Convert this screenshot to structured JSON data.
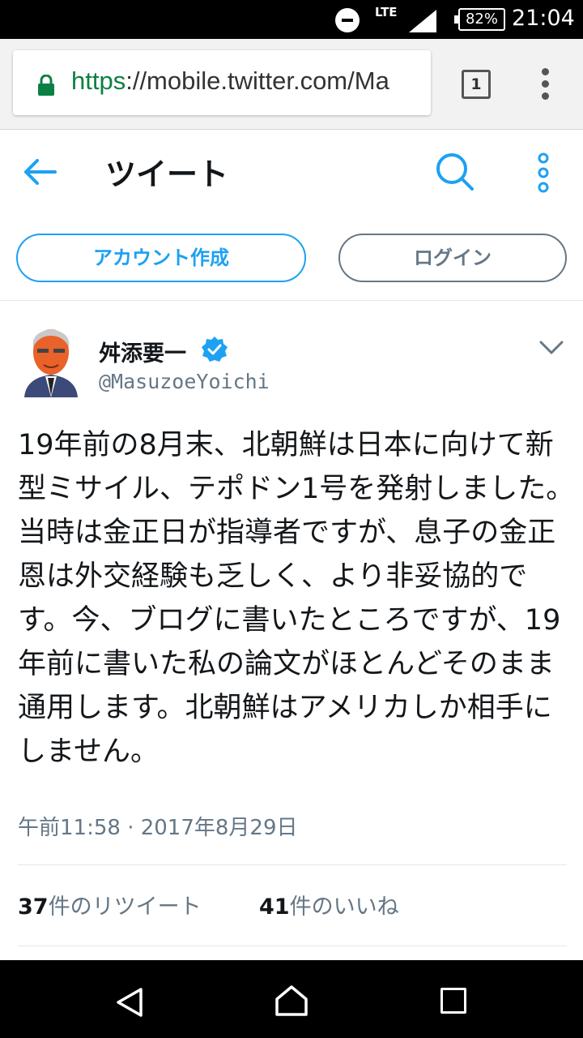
{
  "status_bar": {
    "network": "LTE",
    "battery": "82%",
    "time": "21:04"
  },
  "browser": {
    "url_scheme": "https",
    "url_rest": "://mobile.twitter.com/Ma",
    "tab_count": "1"
  },
  "header": {
    "title": "ツイート",
    "signup_label": "アカウント作成",
    "login_label": "ログイン"
  },
  "tweet": {
    "author_name": "舛添要一",
    "author_handle": "@MasuzoeYoichi",
    "text": "19年前の8月末、北朝鮮は日本に向けて新型ミサイル、テポドン1号を発射しました。当時は金正日が指導者ですが、息子の金正恩は外交経験も乏しく、より非妥協的です。今、ブログに書いたところですが、19年前に書いた私の論文がほとんどそのまま通用します。北朝鮮はアメリカしか相手にしません。",
    "timestamp": "午前11:58 · 2017年8月29日",
    "retweet_count": "37",
    "retweet_label": "件のリツイート",
    "like_count": "41",
    "like_label": "件のいいね"
  },
  "colors": {
    "accent": "#1da1f2",
    "secondary_text": "#657786",
    "verified": "#1da1f2",
    "url_green": "#0b8043"
  }
}
